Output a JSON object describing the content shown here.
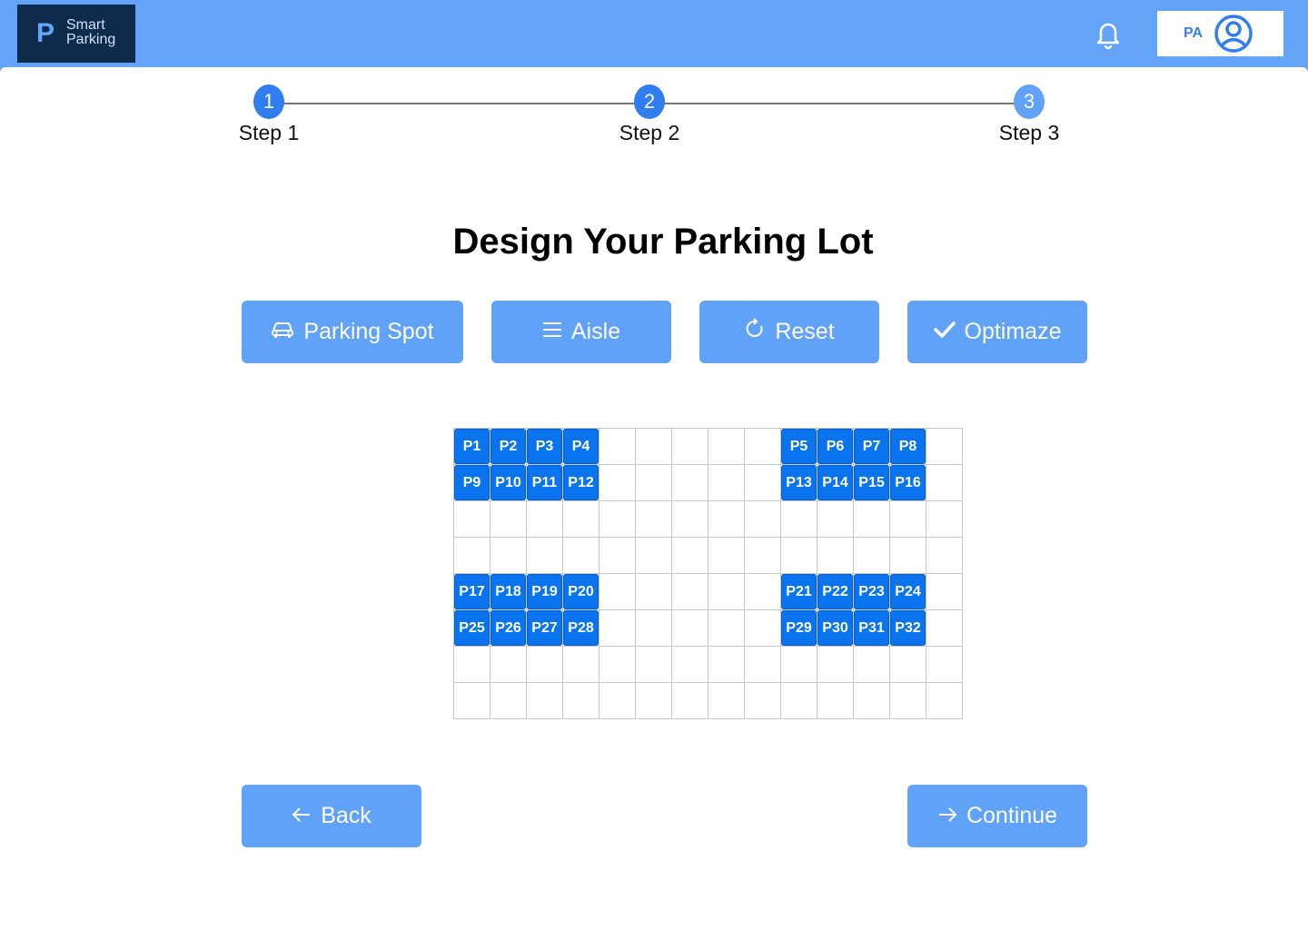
{
  "app": {
    "logo_letter": "P",
    "logo_line1": "Smart",
    "logo_line2": "Parking"
  },
  "header": {
    "user_initials": "PA"
  },
  "steps": [
    {
      "number": "1",
      "label": "Step 1"
    },
    {
      "number": "2",
      "label": "Step 2"
    },
    {
      "number": "3",
      "label": "Step 3"
    }
  ],
  "page_title": "Design Your Parking Lot",
  "toolbar": {
    "parking_spot_label": "Parking Spot",
    "aisle_label": "Aisle",
    "reset_label": "Reset",
    "optimize_label": "Optimaze"
  },
  "lot": {
    "columns": 14,
    "rows": 8,
    "spots": [
      {
        "label": "P1",
        "row": 0,
        "col": 0
      },
      {
        "label": "P2",
        "row": 0,
        "col": 1
      },
      {
        "label": "P3",
        "row": 0,
        "col": 2
      },
      {
        "label": "P4",
        "row": 0,
        "col": 3
      },
      {
        "label": "P5",
        "row": 0,
        "col": 9
      },
      {
        "label": "P6",
        "row": 0,
        "col": 10
      },
      {
        "label": "P7",
        "row": 0,
        "col": 11
      },
      {
        "label": "P8",
        "row": 0,
        "col": 12
      },
      {
        "label": "P9",
        "row": 1,
        "col": 0
      },
      {
        "label": "P10",
        "row": 1,
        "col": 1
      },
      {
        "label": "P11",
        "row": 1,
        "col": 2
      },
      {
        "label": "P12",
        "row": 1,
        "col": 3
      },
      {
        "label": "P13",
        "row": 1,
        "col": 9
      },
      {
        "label": "P14",
        "row": 1,
        "col": 10
      },
      {
        "label": "P15",
        "row": 1,
        "col": 11
      },
      {
        "label": "P16",
        "row": 1,
        "col": 12
      },
      {
        "label": "P17",
        "row": 4,
        "col": 0
      },
      {
        "label": "P18",
        "row": 4,
        "col": 1
      },
      {
        "label": "P19",
        "row": 4,
        "col": 2
      },
      {
        "label": "P20",
        "row": 4,
        "col": 3
      },
      {
        "label": "P21",
        "row": 4,
        "col": 9
      },
      {
        "label": "P22",
        "row": 4,
        "col": 10
      },
      {
        "label": "P23",
        "row": 4,
        "col": 11
      },
      {
        "label": "P24",
        "row": 4,
        "col": 12
      },
      {
        "label": "P25",
        "row": 5,
        "col": 0
      },
      {
        "label": "P26",
        "row": 5,
        "col": 1
      },
      {
        "label": "P27",
        "row": 5,
        "col": 2
      },
      {
        "label": "P28",
        "row": 5,
        "col": 3
      },
      {
        "label": "P29",
        "row": 5,
        "col": 9
      },
      {
        "label": "P30",
        "row": 5,
        "col": 10
      },
      {
        "label": "P31",
        "row": 5,
        "col": 11
      },
      {
        "label": "P32",
        "row": 5,
        "col": 12
      }
    ]
  },
  "footer": {
    "back_label": "Back",
    "continue_label": "Continue"
  },
  "icons": {
    "bell": "bell-icon",
    "avatar": "user-circle-icon",
    "car": "car-icon",
    "aisle": "lines-icon",
    "reset": "refresh-icon",
    "optimize": "check-icon",
    "back": "arrow-left-icon",
    "continue": "arrow-right-icon"
  },
  "colors": {
    "primary": "#63a4f9",
    "spot": "#0a74ee",
    "step_active": "#2f7df0",
    "logo_bg": "#0f2a4a"
  }
}
